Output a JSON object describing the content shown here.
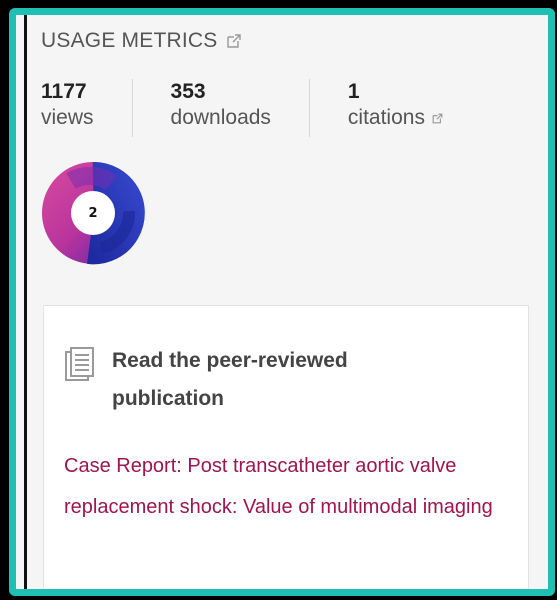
{
  "usage": {
    "title": "USAGE METRICS",
    "metrics": [
      {
        "value": "1177",
        "label": "views"
      },
      {
        "value": "353",
        "label": "downloads"
      },
      {
        "value": "1",
        "label": "citations"
      }
    ]
  },
  "altmetric": {
    "score": "2"
  },
  "publication": {
    "heading": "Read the peer-reviewed publication",
    "link_text": "Case Report: Post transcatheter aortic valve replacement shock: Value of multimodal imaging"
  },
  "colors": {
    "frame_border": "#1fbfb4",
    "link": "#a0144f",
    "altmetric_pink": "#c73aa0",
    "altmetric_blue": "#2b3bbf"
  },
  "icons": [
    "external-link-icon",
    "document-stack-icon"
  ]
}
